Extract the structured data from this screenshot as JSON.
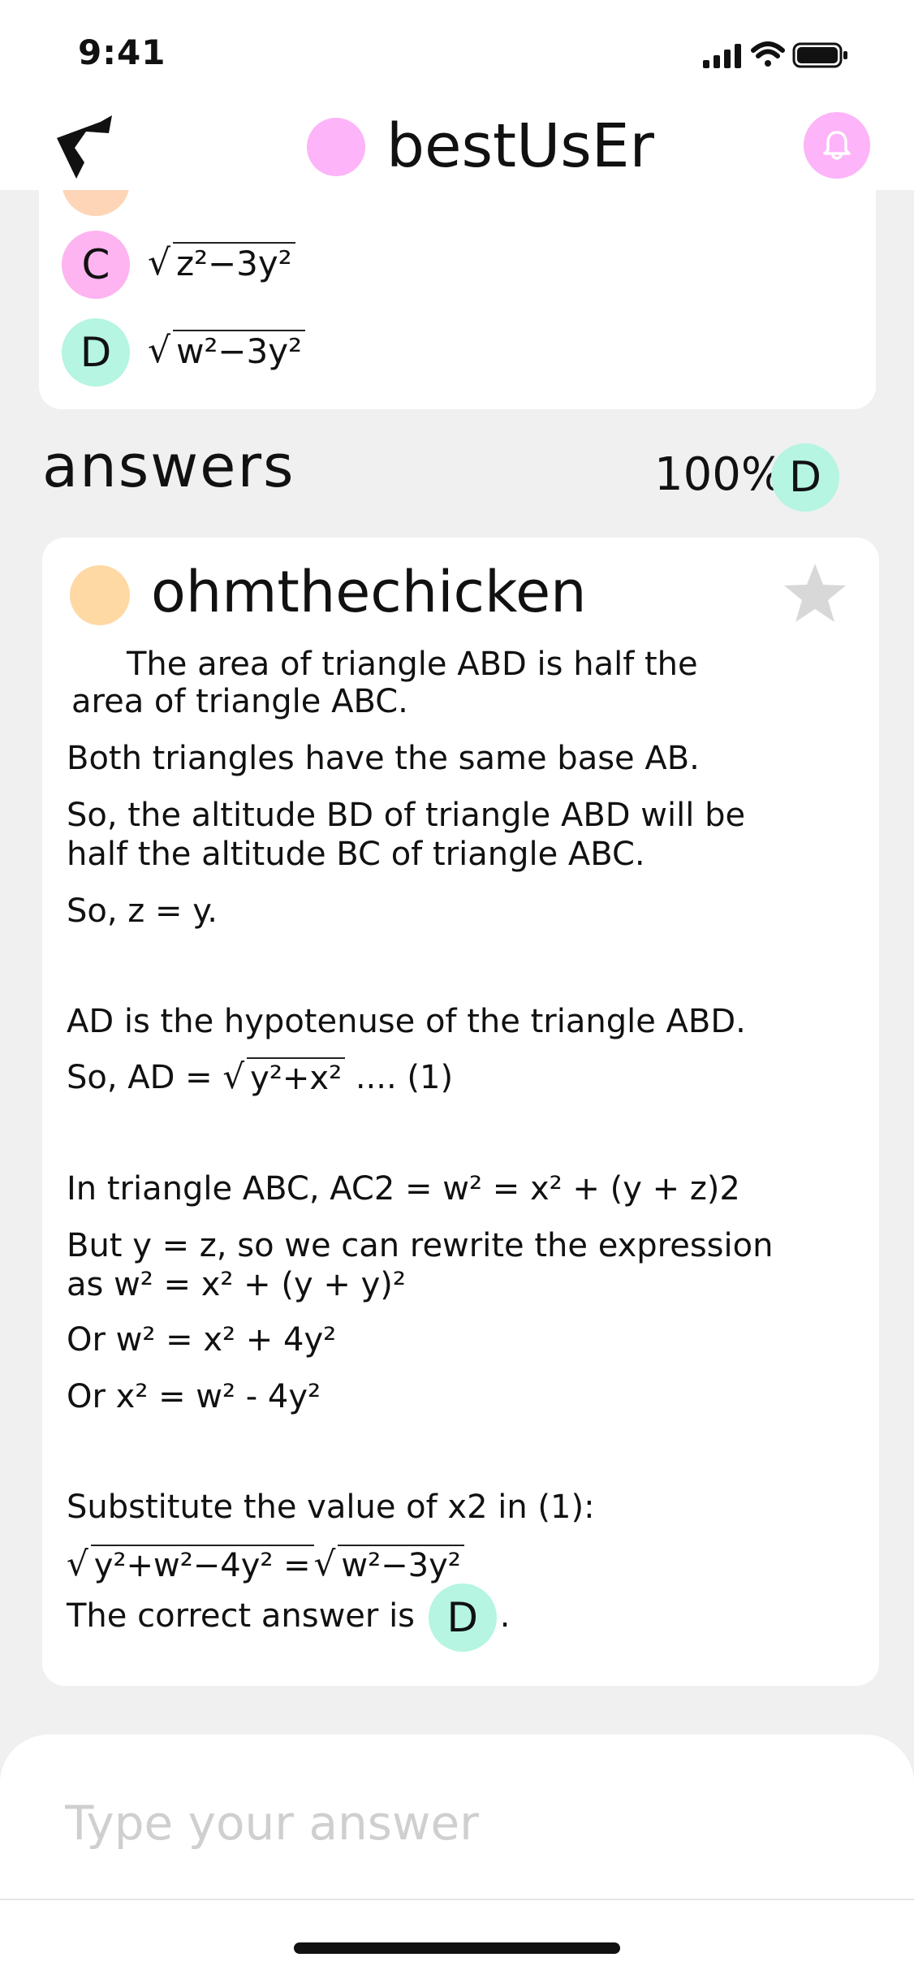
{
  "status_bar": {
    "time": "9:41"
  },
  "header": {
    "username": "bestUsEr",
    "colors": {
      "avatar": "#fdb4f8"
    }
  },
  "question": {
    "options": [
      {
        "letter": "C",
        "radicand": "z²−3y²"
      },
      {
        "letter": "D",
        "radicand": "w²−3y²"
      }
    ]
  },
  "answers_section": {
    "title": "answers",
    "percent": "100%",
    "badge": "D"
  },
  "answer": {
    "author": "ohmthechicken",
    "lines": [
      "The area of triangle ABD is half the",
      "area of triangle ABC.",
      "Both triangles have the same base AB.",
      "So, the altitude BD of triangle ABD will be",
      "half the altitude BC of triangle ABC.",
      "So, z = y.",
      "AD is the hypotenuse of the triangle ABD.",
      "So, AD = ",
      "y²+x²",
      " .... (1)",
      "In triangle ABC, AC2 = w² = x² + (y + z)2",
      "But y = z, so we can rewrite the expression",
      "as w² = x² + (y + y)²",
      "Or w² = x² + 4y²",
      "Or x² = w² - 4y²",
      "Substitute the value of x2 in (1):",
      "y²+w²−4y² = ",
      "w²−3y²",
      "The correct answer is ",
      "D",
      "."
    ]
  },
  "compose": {
    "placeholder": "Type your answer"
  }
}
